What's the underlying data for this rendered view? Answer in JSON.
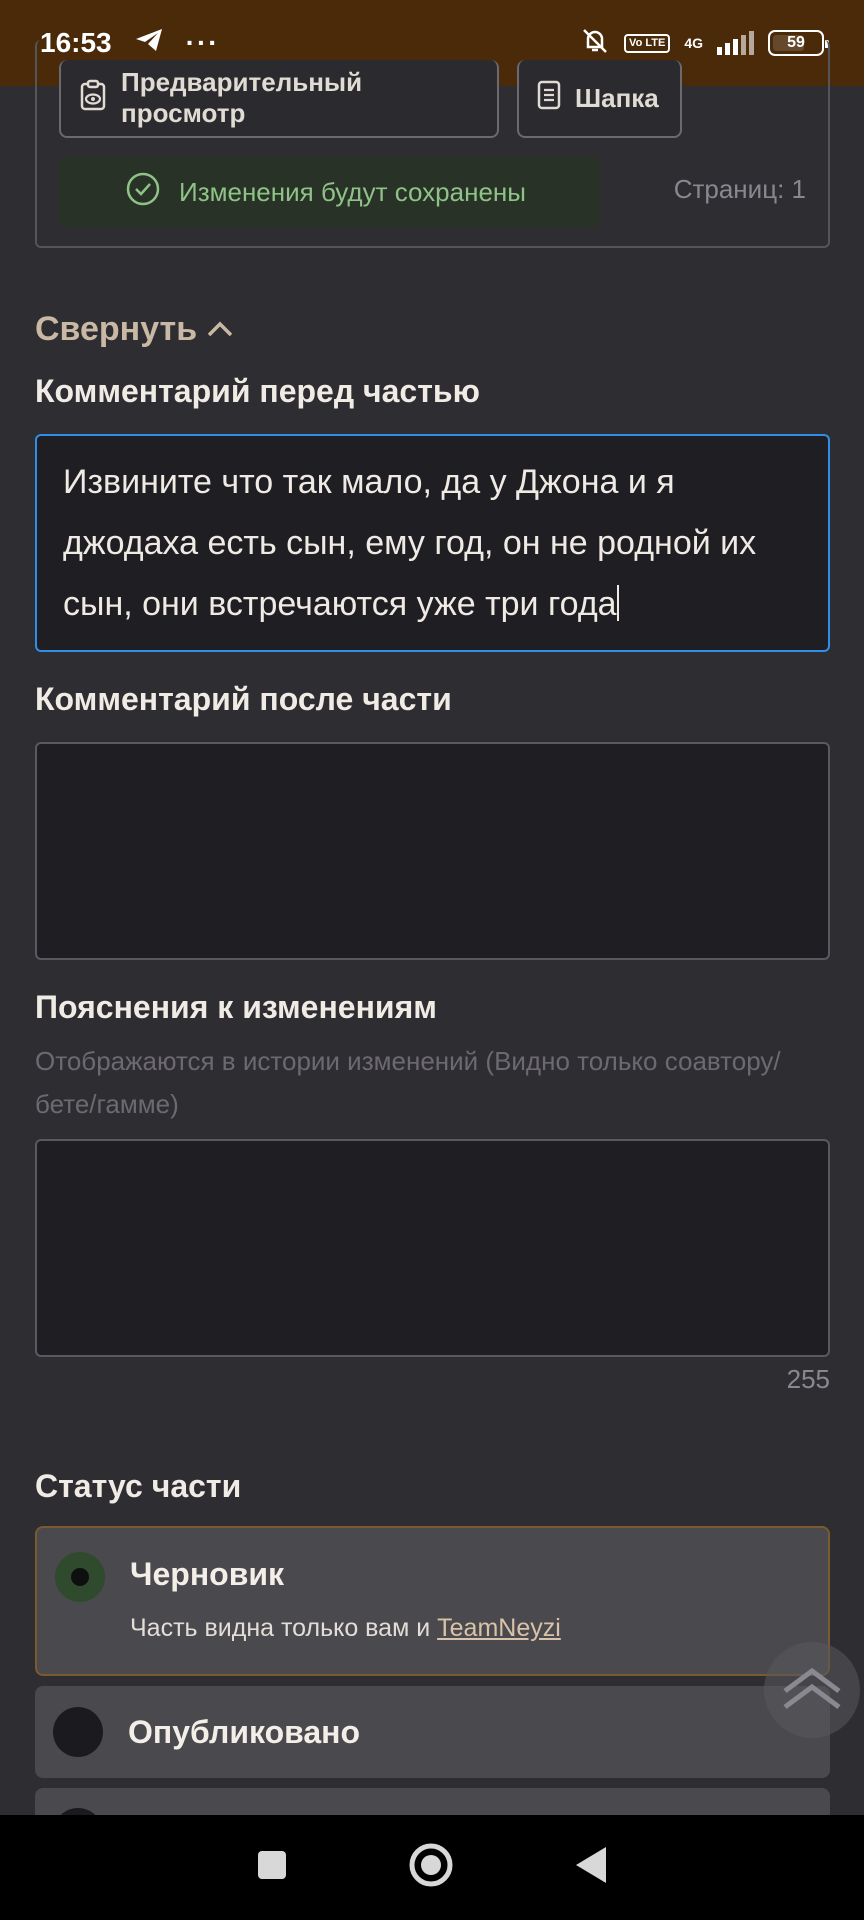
{
  "status_bar": {
    "time": "16:53",
    "volte_label": "Vo LTE",
    "network": "4G",
    "battery": "59"
  },
  "toolbar": {
    "preview_label": "Предварительный просмотр",
    "header_label": "Шапка"
  },
  "save_status": "Изменения будут сохранены",
  "pages_label": "Страниц: 1",
  "collapse_label": "Свернуть",
  "comment_before": {
    "label": "Комментарий перед частью",
    "value": "Извините что так мало, да у Джона и я джодаха есть сын, ему год, он не родной их сын, они встречаются уже три года"
  },
  "comment_after": {
    "label": "Комментарий после части",
    "value": ""
  },
  "change_notes": {
    "label": "Пояснения к изменениям",
    "hint": "Отображаются в истории изменений (Видно только соавтору/бете/гамме)",
    "value": "",
    "counter": "255"
  },
  "status": {
    "label": "Статус части",
    "options": [
      {
        "title": "Черновик",
        "desc_prefix": "Часть видна только вам и ",
        "desc_link": "TeamNeyzi",
        "selected": true
      },
      {
        "title": "Опубликовано",
        "selected": false
      }
    ]
  },
  "colors": {
    "status_bar_bg": "#4a2a08",
    "page_bg": "#2e2d32",
    "focus_border": "#2f8fe6",
    "success_text": "#8fc286",
    "collapse_text": "#c9b8a4"
  },
  "icons": [
    "telegram-icon",
    "more-icon",
    "mute-bell-icon",
    "signal-icon",
    "battery-icon",
    "preview-icon",
    "header-doc-icon",
    "check-circle-icon",
    "chevron-up-icon",
    "scroll-top-icon",
    "nav-recents-icon",
    "nav-home-icon",
    "nav-back-icon"
  ]
}
